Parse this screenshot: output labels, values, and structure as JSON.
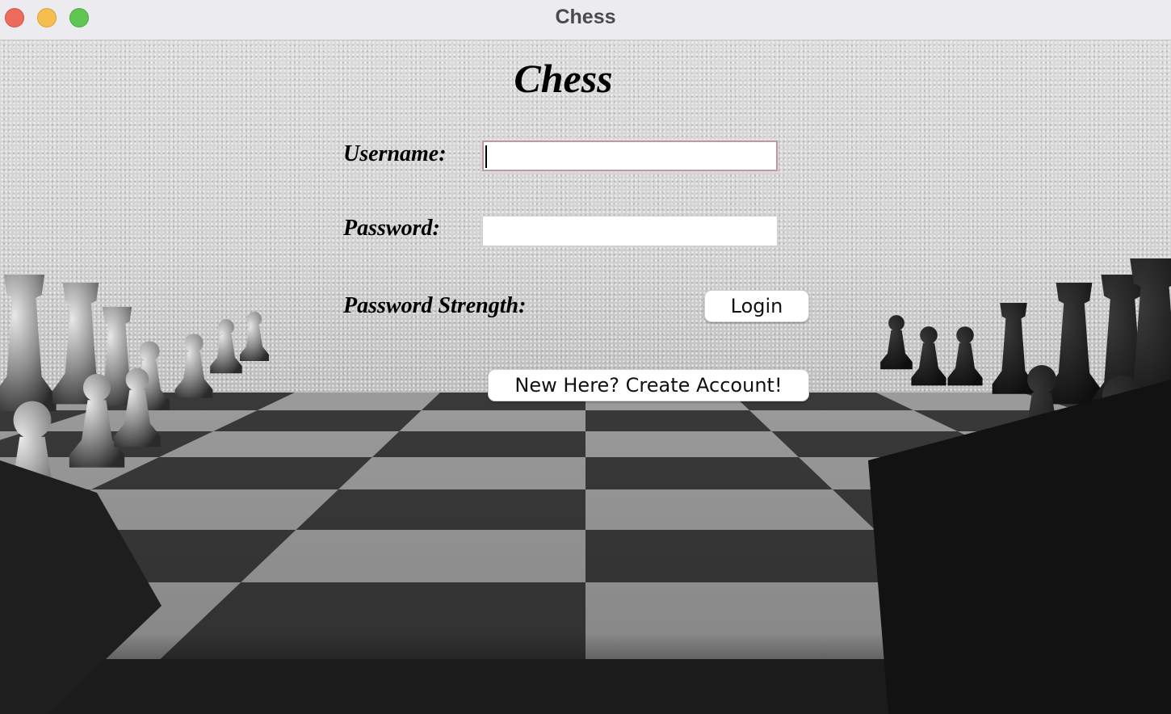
{
  "window": {
    "title": "Chess",
    "controls": [
      "close",
      "minimize",
      "zoom"
    ]
  },
  "app": {
    "title": "Chess"
  },
  "login_form": {
    "username_label": "Username:",
    "username_value": "",
    "password_label": "Password:",
    "password_value": "",
    "strength_label": "Password Strength:",
    "login_button": "Login",
    "create_account_button": "New Here? Create Account!"
  },
  "background": {
    "description_icon": "chessboard-photo",
    "colors": {
      "wall": "#d4d4d4",
      "light_square": "#b9b9b9",
      "dark_square": "#3a3a3a",
      "shadow": "#1b1b1b"
    }
  }
}
